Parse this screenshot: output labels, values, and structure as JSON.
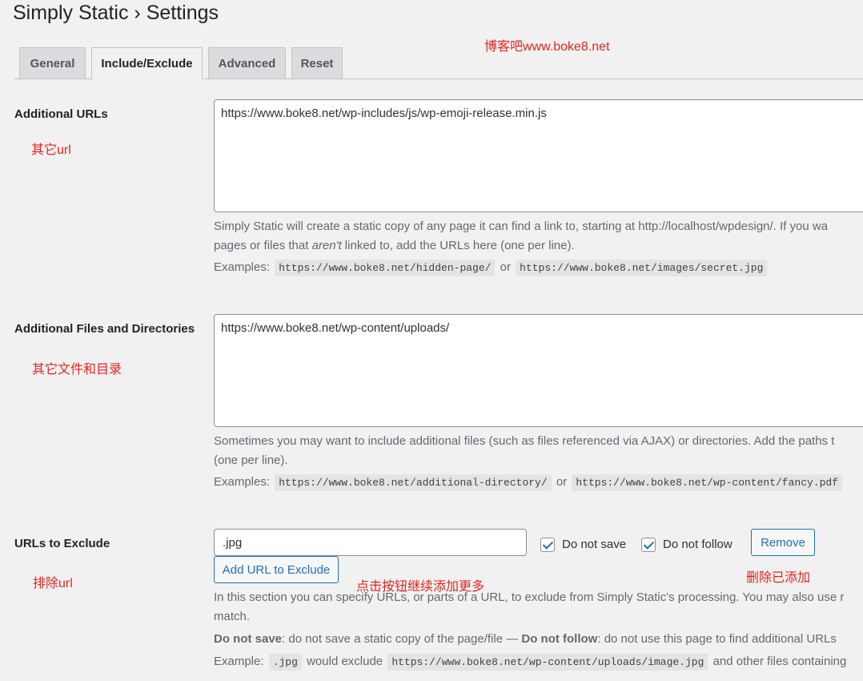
{
  "page": {
    "title": "Simply Static › Settings"
  },
  "watermark": "博客吧www.boke8.net",
  "tabs": [
    {
      "label": "General"
    },
    {
      "label": "Include/Exclude"
    },
    {
      "label": "Advanced"
    },
    {
      "label": "Reset"
    }
  ],
  "active_tab": "Include/Exclude",
  "additional_urls": {
    "label": "Additional URLs",
    "note": "其它url",
    "value": "https://www.boke8.net/wp-includes/js/wp-emoji-release.min.js",
    "desc_line1": "Simply Static will create a static copy of any page it can find a link to, starting at http://localhost/wpdesign/. If you wa",
    "desc_line2_a": "pages or files that ",
    "desc_line2_em": "aren't",
    "desc_line2_b": " linked to, add the URLs here (one per line).",
    "examples_label": "Examples:",
    "example1": "https://www.boke8.net/hidden-page/",
    "or": "or",
    "example2": "https://www.boke8.net/images/secret.jpg"
  },
  "additional_files": {
    "label": "Additional Files and Directories",
    "note": "其它文件和目录",
    "value": "https://www.boke8.net/wp-content/uploads/",
    "desc_line1": "Sometimes you may want to include additional files (such as files referenced via AJAX) or directories. Add the paths t",
    "desc_line2": "(one per line).",
    "examples_label": "Examples:",
    "example1": "https://www.boke8.net/additional-directory/",
    "or": "or",
    "example2": "https://www.boke8.net/wp-content/fancy.pdf"
  },
  "urls_to_exclude": {
    "label": "URLs to Exclude",
    "note": "排除url",
    "value": ".jpg",
    "do_not_save_label": "Do not save",
    "do_not_save_checked": true,
    "do_not_follow_label": "Do not follow",
    "do_not_follow_checked": true,
    "remove_button": "Remove",
    "remove_note": "删除已添加",
    "add_button": "Add URL to Exclude",
    "add_note": "点击按钮继续添加更多",
    "desc_line1": "In this section you can specify URLs, or parts of a URL, to exclude from Simply Static's processing. You may also use r",
    "desc_line2": "match.",
    "dns_strong": "Do not save",
    "dns_text": ": do not save a static copy of the page/file — ",
    "dnf_strong": "Do not follow",
    "dnf_text": ": do not use this page to find additional URLs",
    "example_label": "Example:",
    "example_code1": ".jpg",
    "example_mid": " would exclude ",
    "example_code2": "https://www.boke8.net/wp-content/uploads/image.jpg",
    "example_tail": " and other files containing"
  }
}
